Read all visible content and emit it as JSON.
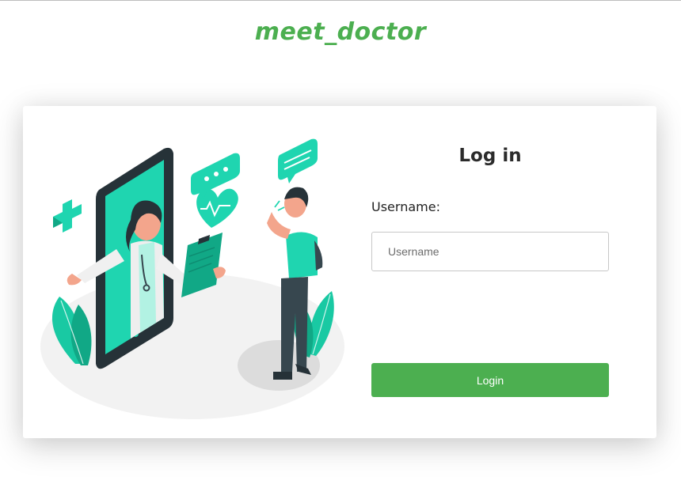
{
  "brand": {
    "title": "meet_doctor",
    "color": "#4caf50"
  },
  "login": {
    "title": "Log in",
    "username_label": "Username:",
    "username_placeholder": "Username",
    "username_value": "",
    "submit_label": "Login"
  },
  "illustration": {
    "description_icon": "doctor-video-call-illustration",
    "accent_color": "#1fd5b0"
  }
}
